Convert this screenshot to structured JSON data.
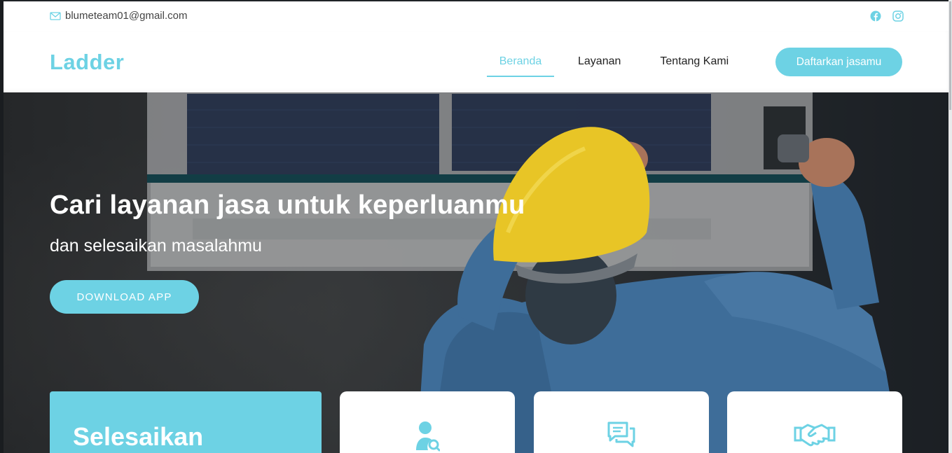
{
  "topbar": {
    "email": "blumeteam01@gmail.com",
    "email_icon": "envelope-icon",
    "social_icons": [
      "facebook-icon",
      "instagram-icon"
    ]
  },
  "header": {
    "logo": "Ladder",
    "nav": [
      {
        "label": "Beranda",
        "active": true
      },
      {
        "label": "Layanan",
        "active": false
      },
      {
        "label": "Tentang Kami",
        "active": false
      }
    ],
    "cta_label": "Daftarkan jasamu"
  },
  "hero": {
    "title": "Cari layanan jasa untuk keperluanmu",
    "subtitle": "dan selesaikan masalahmu",
    "download_label": "DOWNLOAD APP"
  },
  "features": {
    "highlight_title": "Selesaikan",
    "cards": [
      {
        "icon": "user-search-icon"
      },
      {
        "icon": "chat-bubbles-icon"
      },
      {
        "icon": "handshake-icon"
      }
    ]
  },
  "colors": {
    "accent": "#6dd2e4",
    "text": "#222222",
    "white": "#ffffff"
  }
}
